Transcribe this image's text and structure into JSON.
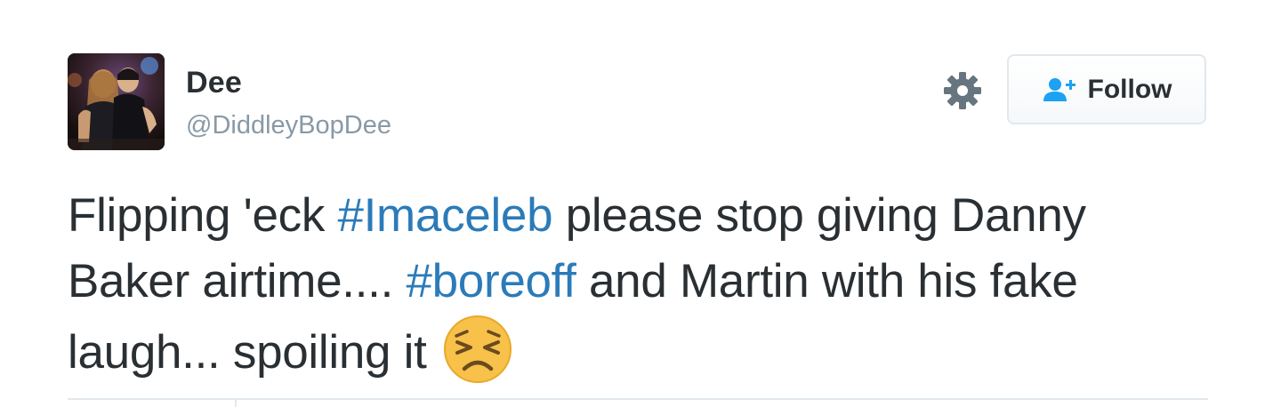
{
  "user": {
    "name": "Dee",
    "handle": "@DiddleyBopDee"
  },
  "actions": {
    "gear_icon": "gear-icon",
    "follow_icon": "add-user-icon",
    "follow_label": "Follow"
  },
  "tweet": {
    "segments": [
      "Flipping 'eck ",
      "#Imaceleb",
      " please stop giving Danny Baker airtime.... ",
      "#boreoff",
      " and Martin  with his fake laugh... spoiling it "
    ],
    "emoji": "persevering-face-emoji"
  },
  "colors": {
    "text": "#292f33",
    "handle": "#8899a6",
    "hashtag": "#2b7bb9",
    "follow_icon": "#1da1f2",
    "border": "#e1e8ed"
  }
}
